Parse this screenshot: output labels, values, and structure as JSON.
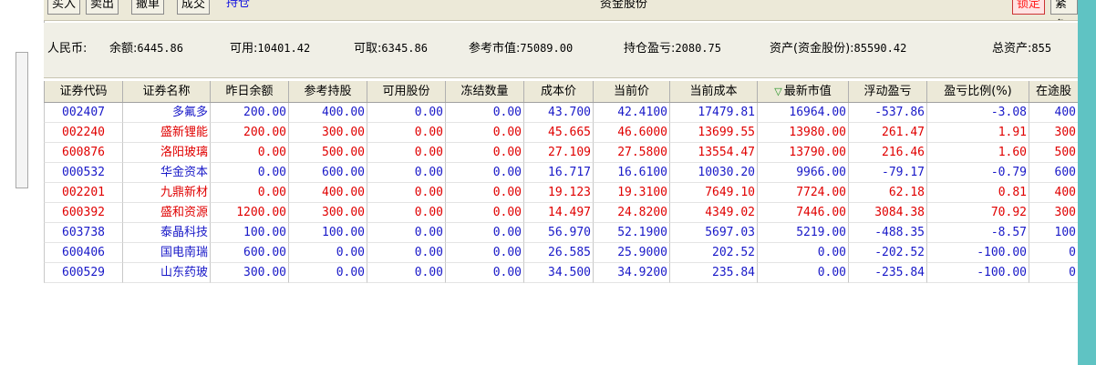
{
  "toolbar": {
    "buttons": [
      "买入",
      "卖出",
      "撤单",
      "成交",
      "持仓"
    ],
    "title": "资金股份",
    "lock_label": "锁定",
    "cut_label": "紧急"
  },
  "summary": {
    "currency": "人民币:",
    "balance_label": "余额:",
    "balance": "6445.86",
    "available_label": "可用:",
    "available": "10401.42",
    "withdrawable_label": "可取:",
    "withdrawable": "6345.86",
    "ref_value_label": "参考市值:",
    "ref_value": "75089.00",
    "position_pnl_label": "持仓盈亏:",
    "position_pnl": "2080.75",
    "assets_label": "资产(资金股份):",
    "assets": "85590.42",
    "total_assets_label": "总资产:",
    "total_assets": "855"
  },
  "table": {
    "headers": [
      "证券代码",
      "证券名称",
      "昨日余额",
      "参考持股",
      "可用股份",
      "冻结数量",
      "成本价",
      "当前价",
      "当前成本",
      "最新市值",
      "浮动盈亏",
      "盈亏比例(%)",
      "在途股"
    ],
    "rows": [
      {
        "code": "002407",
        "name": "多氟多",
        "prev": "200.00",
        "ref_hold": "400.00",
        "avail": "0.00",
        "frozen": "0.00",
        "cost": "43.700",
        "price": "42.4100",
        "cur_cost": "17479.81",
        "mkt": "16964.00",
        "pnl": "-537.86",
        "pct": "-3.08",
        "transit": "400",
        "color": "blue"
      },
      {
        "code": "002240",
        "name": "盛新锂能",
        "prev": "200.00",
        "ref_hold": "300.00",
        "avail": "0.00",
        "frozen": "0.00",
        "cost": "45.665",
        "price": "46.6000",
        "cur_cost": "13699.55",
        "mkt": "13980.00",
        "pnl": "261.47",
        "pct": "1.91",
        "transit": "300",
        "color": "red"
      },
      {
        "code": "600876",
        "name": "洛阳玻璃",
        "prev": "0.00",
        "ref_hold": "500.00",
        "avail": "0.00",
        "frozen": "0.00",
        "cost": "27.109",
        "price": "27.5800",
        "cur_cost": "13554.47",
        "mkt": "13790.00",
        "pnl": "216.46",
        "pct": "1.60",
        "transit": "500",
        "color": "red"
      },
      {
        "code": "000532",
        "name": "华金资本",
        "prev": "0.00",
        "ref_hold": "600.00",
        "avail": "0.00",
        "frozen": "0.00",
        "cost": "16.717",
        "price": "16.6100",
        "cur_cost": "10030.20",
        "mkt": "9966.00",
        "pnl": "-79.17",
        "pct": "-0.79",
        "transit": "600",
        "color": "blue"
      },
      {
        "code": "002201",
        "name": "九鼎新材",
        "prev": "0.00",
        "ref_hold": "400.00",
        "avail": "0.00",
        "frozen": "0.00",
        "cost": "19.123",
        "price": "19.3100",
        "cur_cost": "7649.10",
        "mkt": "7724.00",
        "pnl": "62.18",
        "pct": "0.81",
        "transit": "400",
        "color": "red"
      },
      {
        "code": "600392",
        "name": "盛和资源",
        "prev": "1200.00",
        "ref_hold": "300.00",
        "avail": "0.00",
        "frozen": "0.00",
        "cost": "14.497",
        "price": "24.8200",
        "cur_cost": "4349.02",
        "mkt": "7446.00",
        "pnl": "3084.38",
        "pct": "70.92",
        "transit": "300",
        "color": "red"
      },
      {
        "code": "603738",
        "name": "泰晶科技",
        "prev": "100.00",
        "ref_hold": "100.00",
        "avail": "0.00",
        "frozen": "0.00",
        "cost": "56.970",
        "price": "52.1900",
        "cur_cost": "5697.03",
        "mkt": "5219.00",
        "pnl": "-488.35",
        "pct": "-8.57",
        "transit": "100",
        "color": "blue"
      },
      {
        "code": "600406",
        "name": "国电南瑞",
        "prev": "600.00",
        "ref_hold": "0.00",
        "avail": "0.00",
        "frozen": "0.00",
        "cost": "26.585",
        "price": "25.9000",
        "cur_cost": "202.52",
        "mkt": "0.00",
        "pnl": "-202.52",
        "pct": "-100.00",
        "transit": "0",
        "color": "blue"
      },
      {
        "code": "600529",
        "name": "山东药玻",
        "prev": "300.00",
        "ref_hold": "0.00",
        "avail": "0.00",
        "frozen": "0.00",
        "cost": "34.500",
        "price": "34.9200",
        "cur_cost": "235.84",
        "mkt": "0.00",
        "pnl": "-235.84",
        "pct": "-100.00",
        "transit": "0",
        "color": "blue"
      }
    ]
  },
  "colors": {
    "positive": "#e00000",
    "negative": "#1919c8",
    "header_bg": "#ece9d8",
    "accent_strip": "#5fc3c3"
  }
}
